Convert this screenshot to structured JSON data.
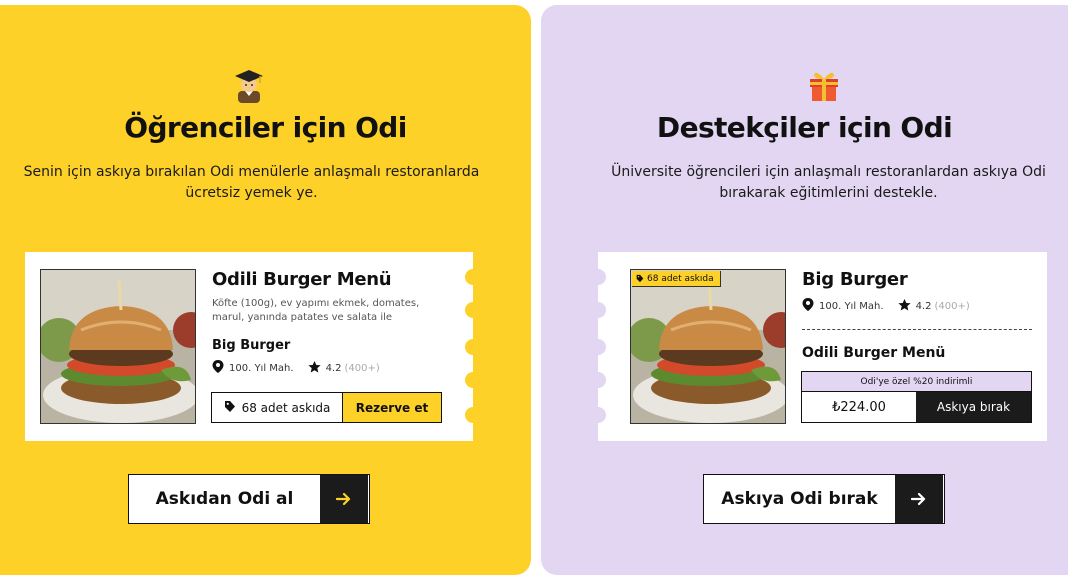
{
  "students": {
    "emoji_icon": "student-emoji-icon",
    "title": "Öğrenciler için Odi",
    "description": "Senin için askıya bırakılan Odi menülerle anlaşmalı restoranlarda ücretsiz yemek ye.",
    "card": {
      "menu_title": "Odili Burger Menü",
      "menu_description": "Köfte (100g), ev yapımı ekmek, domates, marul, yanında patates ve salata ile",
      "item_name": "Big Burger",
      "location": "100. Yıl Mah.",
      "rating": "4.2",
      "rating_count": "(400+)",
      "stock_label": "68 adet askıda",
      "reserve_label": "Rezerve et"
    },
    "cta_label": "Askıdan Odi al",
    "accent_color": "#fdd127"
  },
  "supporters": {
    "emoji_icon": "gift-emoji-icon",
    "title": "Destekçiler için Odi",
    "description": "Üniversite öğrencileri için anlaşmalı restoranlardan askıya Odi bırakarak eğitimlerini destekle.",
    "card": {
      "badge_label": "68 adet askıda",
      "item_name": "Big Burger",
      "location": "100. Yıl Mah.",
      "rating": "4.2",
      "rating_count": "(400+)",
      "menu_title": "Odili Burger Menü",
      "discount_label": "Odi'ye özel %20 indirimli",
      "price": "₺224.00",
      "leave_label": "Askıya bırak"
    },
    "cta_label": "Askıya Odi bırak",
    "accent_color": "#e2d6f2"
  },
  "colors": {
    "yellow": "#fdd127",
    "lavender": "#e2d6f2",
    "dark": "#1b1b1b"
  }
}
